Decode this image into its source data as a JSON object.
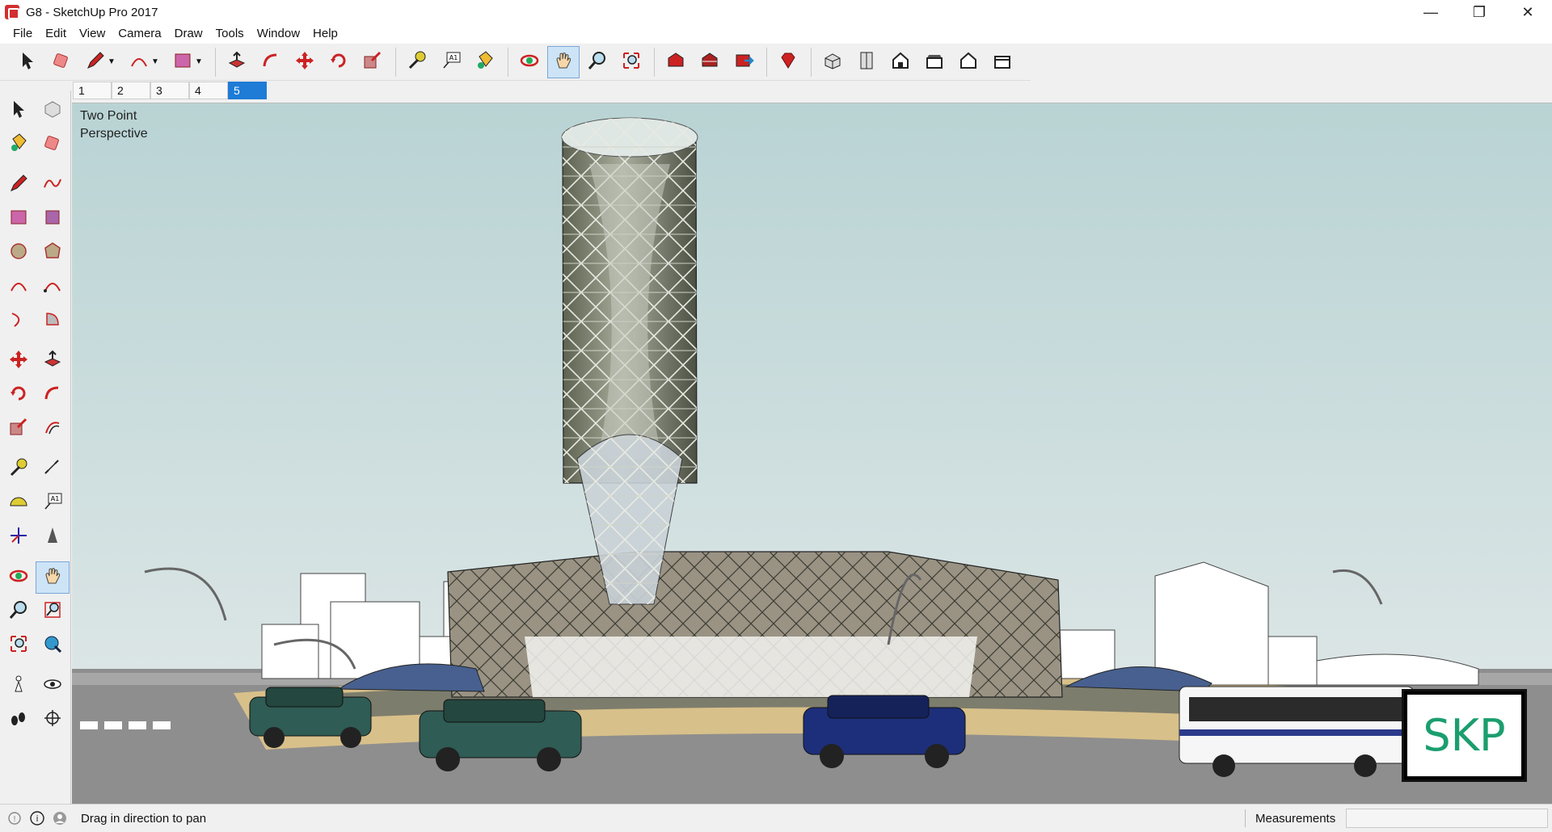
{
  "window": {
    "title": "G8 - SketchUp Pro 2017",
    "minimize_glyph": "—",
    "restore_glyph": "❐",
    "close_glyph": "✕"
  },
  "menu": [
    "File",
    "Edit",
    "View",
    "Camera",
    "Draw",
    "Tools",
    "Window",
    "Help"
  ],
  "toolbar": {
    "items": [
      "select-icon",
      "eraser-icon",
      "pencil-icon",
      "arc-icon",
      "rectangle-icon",
      "push-pull-icon",
      "follow-me-icon",
      "move-icon",
      "rotate-icon",
      "scale-icon",
      "tape-measure-icon",
      "text-icon",
      "paint-bucket-icon",
      "orbit-icon",
      "pan-icon",
      "zoom-icon",
      "zoom-extents-icon",
      "3d-warehouse-icon",
      "extension-warehouse-icon",
      "share-model-icon",
      "ruby-icon",
      "iso-view-icon",
      "top-view-icon",
      "front-view-icon",
      "right-view-icon",
      "back-view-icon",
      "left-view-icon"
    ],
    "active": "pan-icon"
  },
  "scenes": {
    "tabs": [
      "1",
      "2",
      "3",
      "4",
      "5"
    ],
    "active_index": 4
  },
  "sidebar": {
    "rows": [
      [
        "select-icon",
        "component-icon"
      ],
      [
        "paint-bucket-icon",
        "eraser-icon"
      ],
      [
        "pencil-icon",
        "freehand-icon"
      ],
      [
        "rectangle-icon",
        "rotated-rectangle-icon"
      ],
      [
        "circle-icon",
        "polygon-icon"
      ],
      [
        "arc-icon",
        "two-point-arc-icon"
      ],
      [
        "three-point-arc-icon",
        "pie-icon"
      ],
      [
        "move-icon",
        "push-pull-icon"
      ],
      [
        "rotate-icon",
        "follow-me-icon"
      ],
      [
        "scale-icon",
        "offset-icon"
      ],
      [
        "tape-measure-icon",
        "dimension-icon"
      ],
      [
        "protractor-icon",
        "text-icon"
      ],
      [
        "axes-icon",
        "3d-text-icon"
      ],
      [
        "orbit-icon",
        "pan-icon"
      ],
      [
        "zoom-icon",
        "zoom-window-icon"
      ],
      [
        "zoom-extents-icon",
        "previous-view-icon"
      ],
      [
        "position-camera-icon",
        "look-around-icon"
      ],
      [
        "walk-icon",
        "section-plane-icon"
      ]
    ],
    "active": "pan-icon"
  },
  "viewport": {
    "camera_label_line1": "Two Point",
    "camera_label_line2": "Perspective",
    "watermark": "SKP",
    "sky_top": "#b9d3d4",
    "sky_bottom": "#dde6e6",
    "ground_color": "#8c8c8c"
  },
  "status": {
    "hint": "Drag in direction to pan",
    "measurements_label": "Measurements",
    "measurements_value": ""
  }
}
